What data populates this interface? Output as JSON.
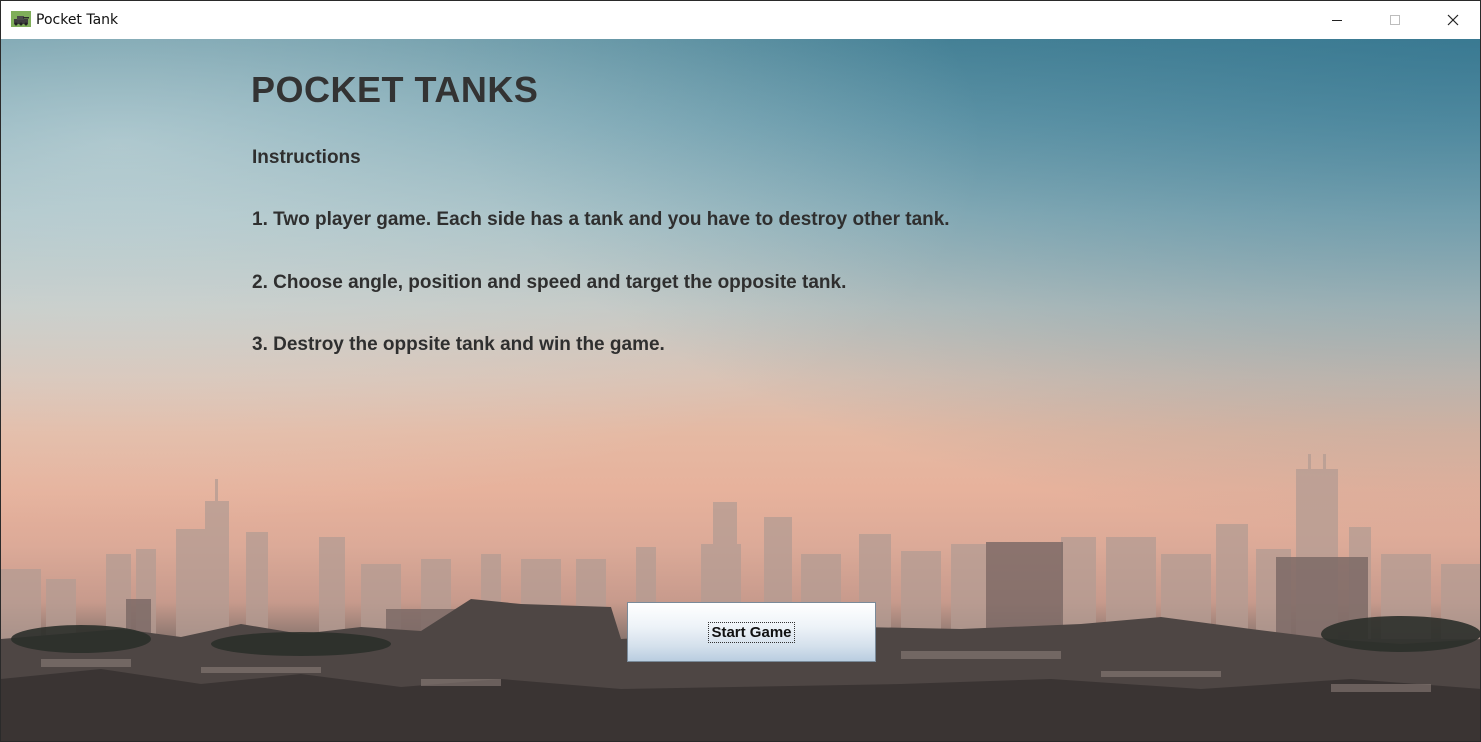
{
  "window": {
    "title": "Pocket Tank",
    "icon": "tank-app-icon",
    "controls": [
      "minimize-icon",
      "maximize-icon",
      "close-icon"
    ]
  },
  "game": {
    "title": "POCKET TANKS",
    "instructions_heading": "Instructions",
    "instructions": [
      "1. Two player game. Each side has a tank and you have to destroy other tank.",
      "2. Choose angle, position and speed and target the opposite tank.",
      "3. Destroy the oppsite tank and win the game."
    ],
    "start_button_label": "Start Game"
  },
  "colors": {
    "text": "#333333",
    "button_top": "#ffffff",
    "button_bottom": "#b9cde0"
  }
}
